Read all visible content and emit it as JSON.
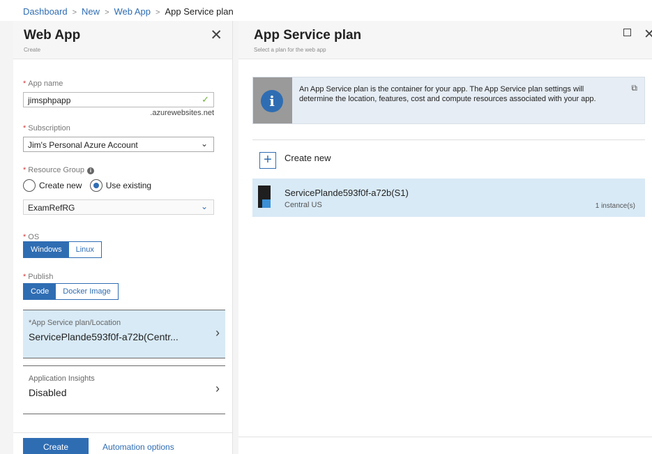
{
  "breadcrumb": {
    "items": [
      "Dashboard",
      "New",
      "Web App"
    ],
    "current": "App Service plan",
    "separator": ">"
  },
  "web_app": {
    "title": "Web App",
    "subtitle": "Create",
    "close_glyph": "✕",
    "app_name": {
      "label": "App name",
      "value": "jimsphpapp",
      "suffix": ".azurewebsites.net",
      "valid": true
    },
    "subscription": {
      "label": "Subscription",
      "value": "Jim's Personal Azure Account"
    },
    "resource_group": {
      "label": "Resource Group",
      "option_create": "Create new",
      "option_existing": "Use existing",
      "selected": "Use existing",
      "value": "ExamRefRG"
    },
    "os": {
      "label": "OS",
      "options": [
        "Windows",
        "Linux"
      ],
      "selected": "Windows"
    },
    "publish": {
      "label": "Publish",
      "options": [
        "Code",
        "Docker Image"
      ],
      "selected": "Code"
    },
    "service_plan": {
      "label": "App Service plan/Location",
      "value": "ServicePlande593f0f-a72b(Centr..."
    },
    "app_insights": {
      "label": "Application Insights",
      "value": "Disabled"
    },
    "create_label": "Create",
    "automation_label": "Automation options"
  },
  "service_plan_blade": {
    "title": "App Service plan",
    "subtitle": "Select a plan for the web app",
    "info_text": "An App Service plan is the container for your app. The App Service plan settings will determine the location, features, cost and compute resources associated with your app.",
    "create_new_label": "Create new",
    "plan": {
      "name": "ServicePlande593f0f-a72b(S1)",
      "location": "Central US",
      "instances": "1 instance(s)"
    }
  },
  "colors": {
    "accent": "#2f6db3",
    "selected_row": "#d8eaf6",
    "required": "#d63a3a",
    "valid_check": "#6fb23a"
  }
}
